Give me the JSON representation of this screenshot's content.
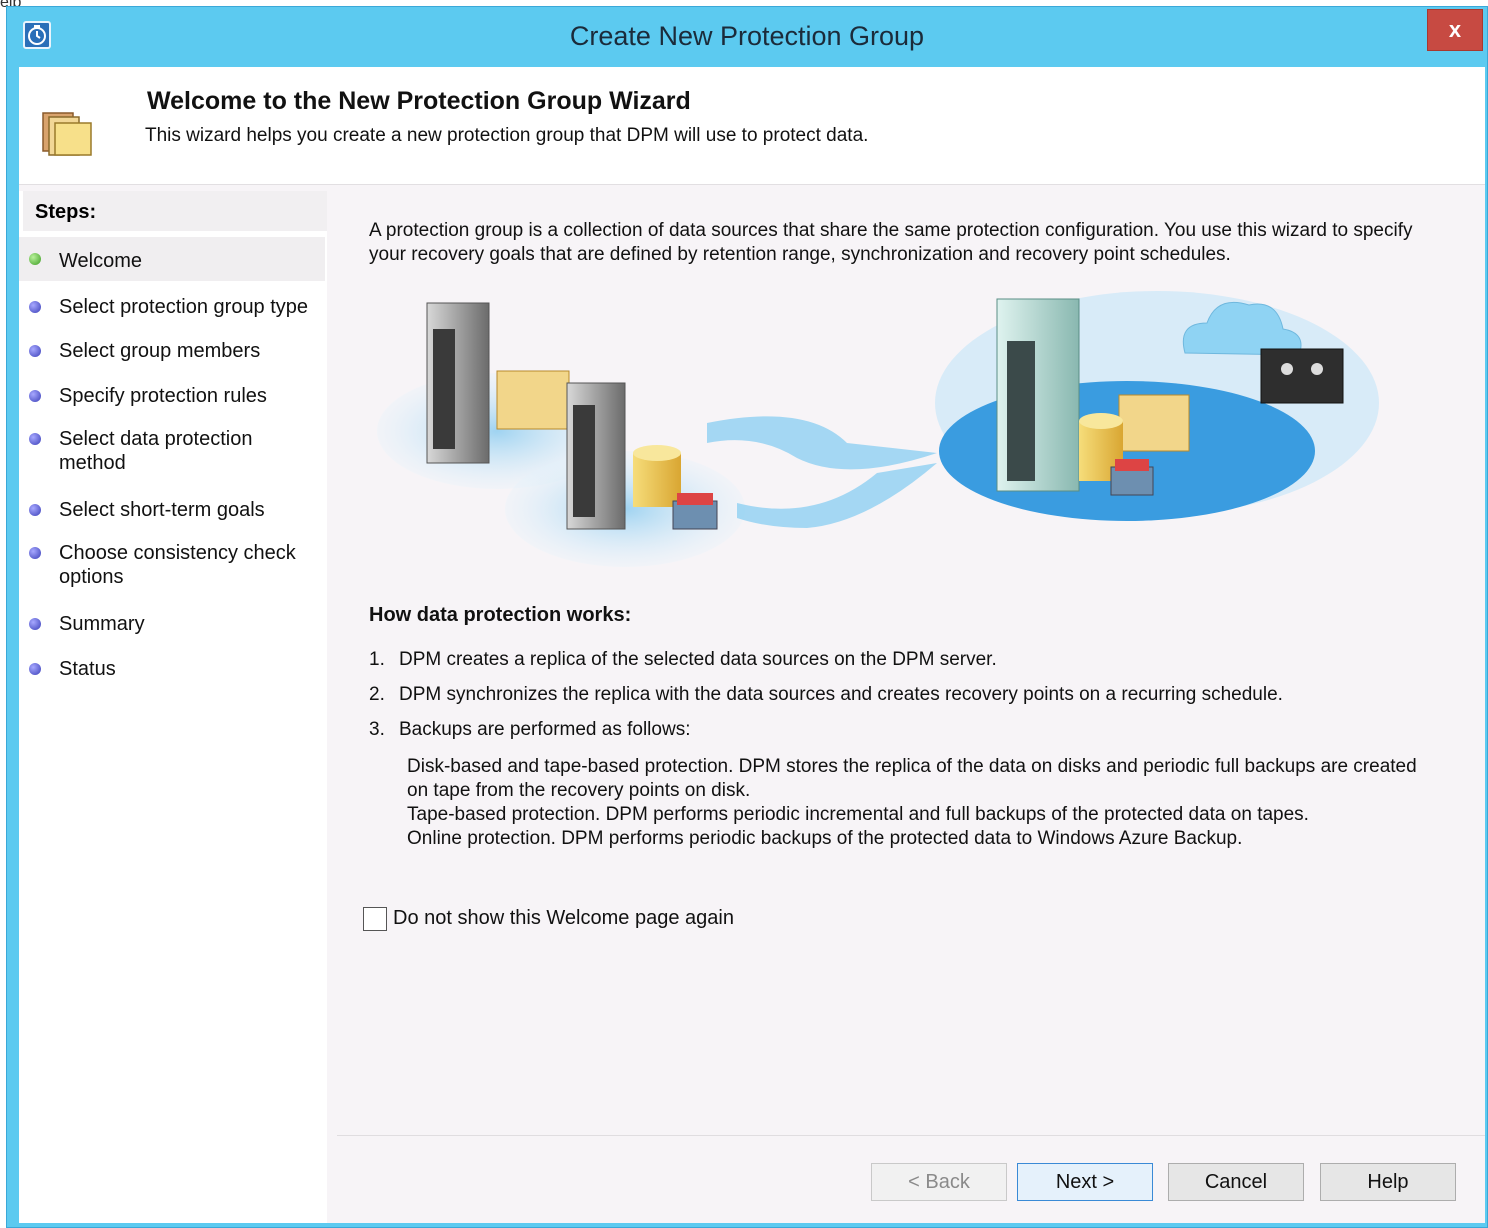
{
  "background": {
    "label": "elp"
  },
  "window": {
    "title": "Create New Protection Group",
    "close_label": "x"
  },
  "header": {
    "title": "Welcome to the New Protection Group Wizard",
    "subtitle": "This wizard helps you create a new protection group that DPM will use to protect data."
  },
  "steps": {
    "title": "Steps:",
    "items": [
      {
        "label": "Welcome",
        "active": true
      },
      {
        "label": "Select protection group type"
      },
      {
        "label": "Select group members"
      },
      {
        "label": "Specify protection rules"
      },
      {
        "label": "Select data protection method"
      },
      {
        "label": "Select short-term goals"
      },
      {
        "label": "Choose consistency check options"
      },
      {
        "label": "Summary"
      },
      {
        "label": "Status"
      }
    ]
  },
  "content": {
    "intro": "A protection group is a collection of data sources that share the same protection configuration. You use this wizard to specify your recovery goals that are defined by retention range, synchronization and recovery point schedules.",
    "how_title": "How data protection works:",
    "list": [
      {
        "num": "1.",
        "text": "DPM creates a replica of the selected data sources on the DPM server."
      },
      {
        "num": "2.",
        "text": "DPM synchronizes the replica with the data sources and creates recovery points on a recurring schedule."
      },
      {
        "num": "3.",
        "text": "Backups are performed as follows:"
      }
    ],
    "details": [
      "Disk-based and tape-based protection. DPM stores the replica of the data on disks and periodic full backups are created on tape from the recovery points on disk.",
      "Tape-based protection. DPM performs periodic incremental and full backups of the protected data on tapes.",
      "Online protection. DPM performs periodic backups of the protected data to Windows Azure Backup."
    ],
    "no_show_label": "Do not show this Welcome page again",
    "no_show_checked": false
  },
  "buttons": {
    "back": "< Back",
    "next": "Next >",
    "cancel": "Cancel",
    "help": "Help"
  },
  "colors": {
    "titlebar": "#5ccaf0",
    "close": "#c74a42",
    "step_active_dot": "#3c9c23",
    "step_dot": "#3a3fb8"
  }
}
